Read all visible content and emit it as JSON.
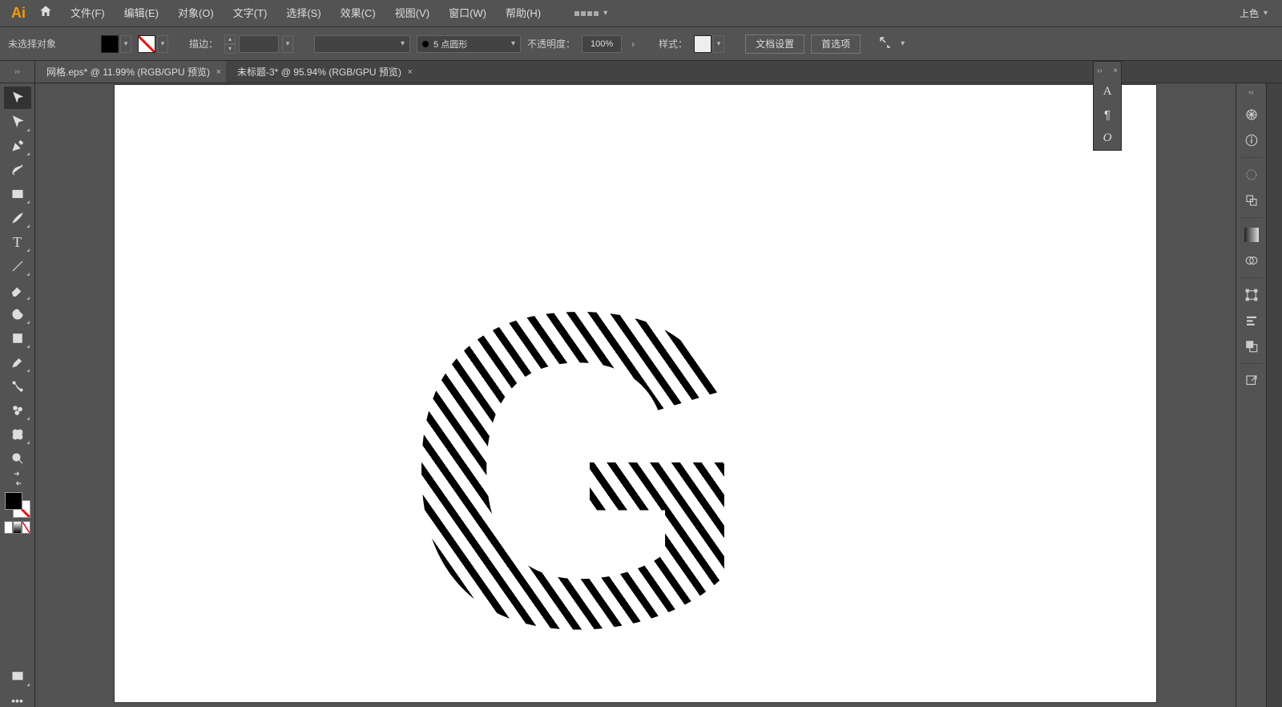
{
  "app": {
    "logo": "Ai"
  },
  "menu": {
    "file": "文件(F)",
    "edit": "编辑(E)",
    "object": "对象(O)",
    "type": "文字(T)",
    "select": "选择(S)",
    "effect": "效果(C)",
    "view": "视图(V)",
    "window": "窗口(W)",
    "help": "帮助(H)"
  },
  "workspace_label": "上色",
  "control": {
    "selection_label": "未选择对象",
    "stroke_label": "描边：",
    "stroke_value": "",
    "brush_profile_label": "5 点圆形",
    "opacity_label": "不透明度：",
    "opacity_value": "100%",
    "style_label": "样式：",
    "doc_setup_btn": "文档设置",
    "prefs_btn": "首选项"
  },
  "tabs": [
    {
      "title": "网格.eps* @ 11.99% (RGB/GPU 预览)",
      "active": false
    },
    {
      "title": "未标题-3* @ 95.94% (RGB/GPU 预览)",
      "active": true
    }
  ],
  "tools": [
    "selection",
    "direct-selection",
    "pen",
    "curvature",
    "rectangle",
    "paintbrush",
    "type",
    "line",
    "eraser",
    "rotate",
    "width",
    "eyedropper",
    "blend",
    "symbol-sprayer",
    "artboard",
    "zoom"
  ],
  "charpanel_icons": [
    "character-A",
    "paragraph",
    "opentype-O"
  ],
  "rightdock_icons": [
    "color-wheel",
    "info",
    "sep",
    "appearance-sun",
    "graphic-styles",
    "sep",
    "gradient",
    "transparency",
    "sep",
    "align-grid",
    "align",
    "pathfinder",
    "sep",
    "export"
  ],
  "canvas_letter": "G"
}
